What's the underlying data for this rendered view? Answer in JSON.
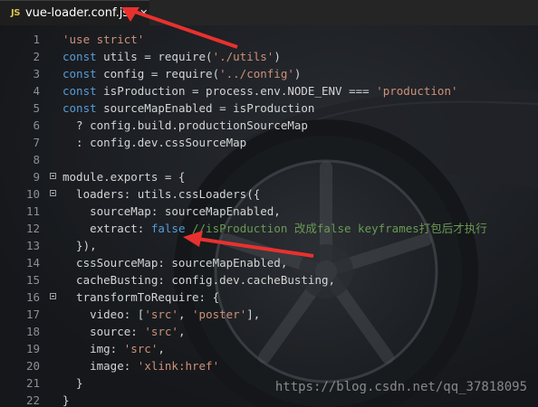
{
  "tab": {
    "icon": "JS",
    "title": "vue-loader.conf.js",
    "close": "✕"
  },
  "lines": [
    {
      "n": "1",
      "parts": [
        [
          "str",
          "'use strict'"
        ]
      ]
    },
    {
      "n": "2",
      "parts": [
        [
          "kw",
          "const "
        ],
        [
          "id",
          "utils = require("
        ],
        [
          "str",
          "'./utils'"
        ],
        [
          "id",
          ")"
        ]
      ]
    },
    {
      "n": "3",
      "parts": [
        [
          "kw",
          "const "
        ],
        [
          "id",
          "config = require("
        ],
        [
          "str",
          "'../config'"
        ],
        [
          "id",
          ")"
        ]
      ]
    },
    {
      "n": "4",
      "parts": [
        [
          "kw",
          "const "
        ],
        [
          "id",
          "isProduction = process.env.NODE_ENV === "
        ],
        [
          "str",
          "'production'"
        ]
      ]
    },
    {
      "n": "5",
      "parts": [
        [
          "kw",
          "const "
        ],
        [
          "id",
          "sourceMapEnabled = isProduction"
        ]
      ]
    },
    {
      "n": "6",
      "parts": [
        [
          "id",
          "  ? config.build.productionSourceMap"
        ]
      ]
    },
    {
      "n": "7",
      "parts": [
        [
          "id",
          "  : config.dev.cssSourceMap"
        ]
      ]
    },
    {
      "n": "8",
      "parts": []
    },
    {
      "n": "9",
      "fold": true,
      "parts": [
        [
          "id",
          "module.exports = {"
        ]
      ]
    },
    {
      "n": "10",
      "fold": true,
      "parts": [
        [
          "id",
          "  loaders: utils.cssLoaders({"
        ]
      ]
    },
    {
      "n": "11",
      "parts": [
        [
          "id",
          "    sourceMap: sourceMapEnabled,"
        ]
      ]
    },
    {
      "n": "12",
      "parts": [
        [
          "id",
          "    extract: "
        ],
        [
          "bool",
          "false"
        ],
        [
          "cm",
          " //isProduction 改成false keyframes打包后才执行"
        ]
      ]
    },
    {
      "n": "13",
      "parts": [
        [
          "id",
          "  }),"
        ]
      ]
    },
    {
      "n": "14",
      "parts": [
        [
          "id",
          "  cssSourceMap: sourceMapEnabled,"
        ]
      ]
    },
    {
      "n": "15",
      "parts": [
        [
          "id",
          "  cacheBusting: config.dev.cacheBusting,"
        ]
      ]
    },
    {
      "n": "16",
      "fold": true,
      "parts": [
        [
          "id",
          "  transformToRequire: {"
        ]
      ]
    },
    {
      "n": "17",
      "parts": [
        [
          "id",
          "    video: ["
        ],
        [
          "str",
          "'src'"
        ],
        [
          "id",
          ", "
        ],
        [
          "str",
          "'poster'"
        ],
        [
          "id",
          "],"
        ]
      ]
    },
    {
      "n": "18",
      "parts": [
        [
          "id",
          "    source: "
        ],
        [
          "str",
          "'src'"
        ],
        [
          "id",
          ","
        ]
      ]
    },
    {
      "n": "19",
      "parts": [
        [
          "id",
          "    img: "
        ],
        [
          "str",
          "'src'"
        ],
        [
          "id",
          ","
        ]
      ]
    },
    {
      "n": "20",
      "parts": [
        [
          "id",
          "    image: "
        ],
        [
          "str",
          "'xlink:href'"
        ]
      ]
    },
    {
      "n": "21",
      "parts": [
        [
          "id",
          "  }"
        ]
      ]
    },
    {
      "n": "22",
      "parts": [
        [
          "id",
          "}"
        ]
      ]
    }
  ],
  "watermark": "https://blog.csdn.net/qq_37818095",
  "colors": {
    "background": "#1f2226",
    "string": "#ce9178",
    "keyword": "#569cd6",
    "comment": "#6a9955",
    "arrow": "#e8312f"
  }
}
